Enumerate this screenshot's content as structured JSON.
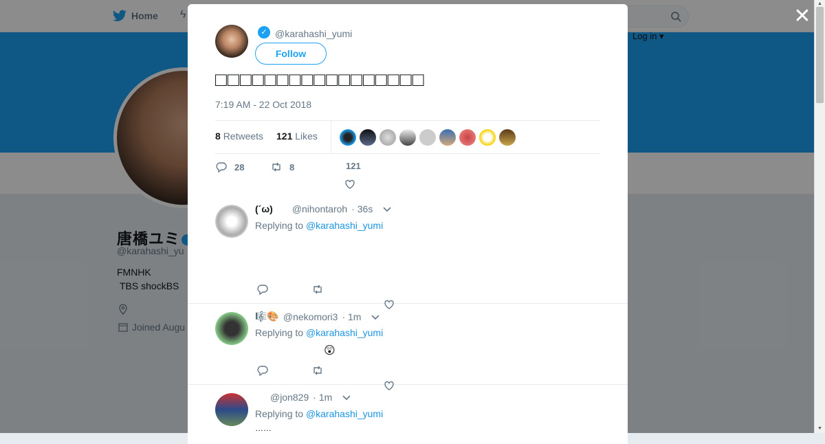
{
  "nav": {
    "home_label": "Home",
    "login_label": "Log in ▾"
  },
  "profile": {
    "name": "唐橋ユミ",
    "handle": "@karahashi_yu",
    "bio_line1": "FMNHK",
    "bio_line2": "TBS  shockBS",
    "joined": "Joined Augu"
  },
  "tweet": {
    "handle": "@karahashi_yumi",
    "follow_label": "Follow",
    "text": "□□□□□□□□□□□□□□□□□",
    "timestamp": "7:19 AM - 22 Oct 2018",
    "retweets_count": "8",
    "retweets_label": "Retweets",
    "likes_count": "121",
    "likes_label": "Likes",
    "actions": {
      "replies": "28",
      "retweets": "8",
      "likes": "121"
    }
  },
  "replies": [
    {
      "name": "(´ω)",
      "handle": "@nihontaroh",
      "age": "· 36s",
      "replying_prefix": "Replying to",
      "replying_to": "@karahashi_yumi",
      "body": ""
    },
    {
      "name": "🎼🎨",
      "handle": "@nekomori3",
      "age": "· 1m",
      "replying_prefix": "Replying to",
      "replying_to": "@karahashi_yumi",
      "body": "😲"
    },
    {
      "name": "",
      "handle": "@jon829",
      "age": "· 1m",
      "replying_prefix": "Replying to",
      "replying_to": "@karahashi_yumi",
      "body": "……"
    }
  ],
  "colors": {
    "accent": "#1da1f2",
    "link": "#1b95e0",
    "muted": "#657786"
  }
}
